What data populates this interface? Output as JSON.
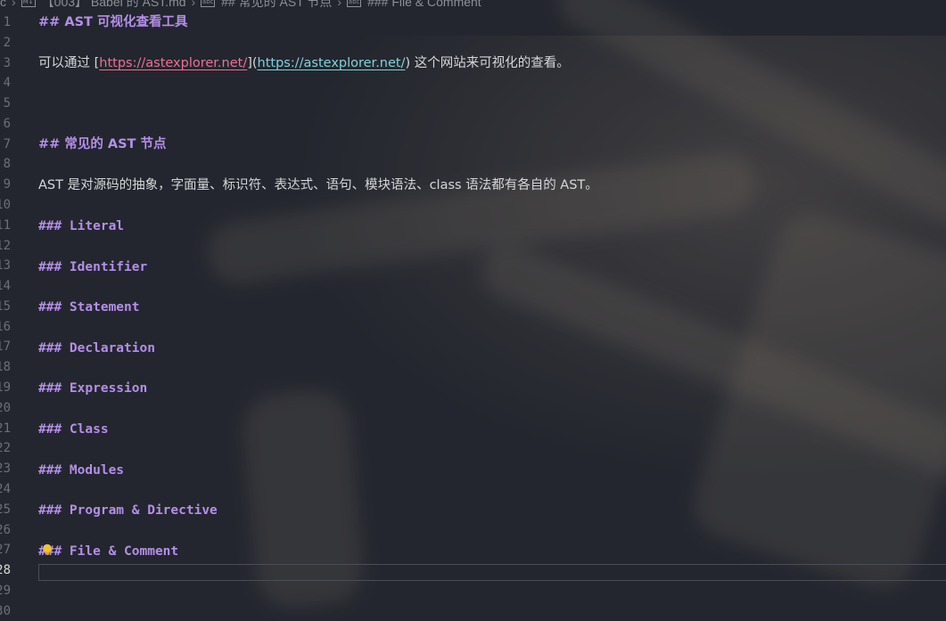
{
  "breadcrumb": {
    "items": [
      "c",
      "【003】 Babel 的 AST.md",
      "## 常见的 AST 节点",
      "### File & Comment"
    ]
  },
  "editor": {
    "line_numbers": [
      "1",
      "2",
      "3",
      "4",
      "5",
      "6",
      "7",
      "8",
      "9",
      "10",
      "11",
      "12",
      "13",
      "14",
      "15",
      "16",
      "17",
      "18",
      "19",
      "20",
      "21",
      "22",
      "23",
      "24",
      "25",
      "26",
      "27",
      "28",
      "29",
      "30"
    ],
    "active_line": "28",
    "lines": {
      "l1": "## AST 可视化查看工具",
      "l3_prefix": "可以通过 ",
      "l3_link_text": "https://astexplorer.net/",
      "l3_link_url": "https://astexplorer.net/",
      "l3_suffix": " 这个网站来可视化的查看。",
      "l7": "## 常见的 AST 节点",
      "l9": "AST 是对源码的抽象，字面量、标识符、表达式、语句、模块语法、class 语法都有各自的 AST。",
      "l11": "### Literal",
      "l13": "### Identifier",
      "l15": "### Statement",
      "l17": "### Declaration",
      "l19": "### Expression",
      "l21": "### Class",
      "l23": "### Modules",
      "l25": "### Program & Directive",
      "l27": "### File & Comment"
    }
  },
  "colors": {
    "background": "#23262e",
    "heading": "#b48ee8",
    "link_text": "#ee6f95",
    "link_url": "#7fd2dc",
    "text": "#d4d6da"
  }
}
